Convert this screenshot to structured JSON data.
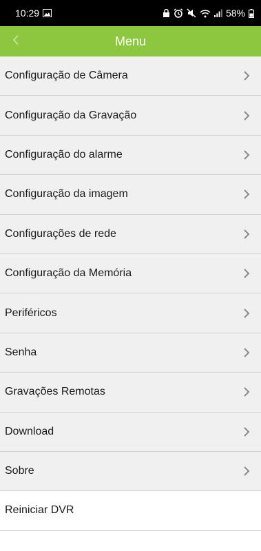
{
  "status_bar": {
    "time": "10:29",
    "battery": "58%",
    "icons": [
      "image-icon",
      "lock-icon",
      "alarm-icon",
      "mute-icon",
      "wifi-icon",
      "signal-icon",
      "battery-icon"
    ]
  },
  "app_bar": {
    "title": "Menu",
    "back_icon": "chevron-left-icon",
    "color": "#8dc63f"
  },
  "menu": {
    "items": [
      {
        "label": "Configuração de Câmera"
      },
      {
        "label": "Configuração da Gravação"
      },
      {
        "label": "Configuração do alarme"
      },
      {
        "label": "Configuração da imagem"
      },
      {
        "label": "Configurações de rede"
      },
      {
        "label": "Configuração da Memória"
      },
      {
        "label": "Periféricos"
      },
      {
        "label": "Senha"
      },
      {
        "label": "Gravações Remotas"
      },
      {
        "label": "Download"
      },
      {
        "label": "Sobre"
      },
      {
        "label": "Reiniciar DVR"
      }
    ]
  }
}
